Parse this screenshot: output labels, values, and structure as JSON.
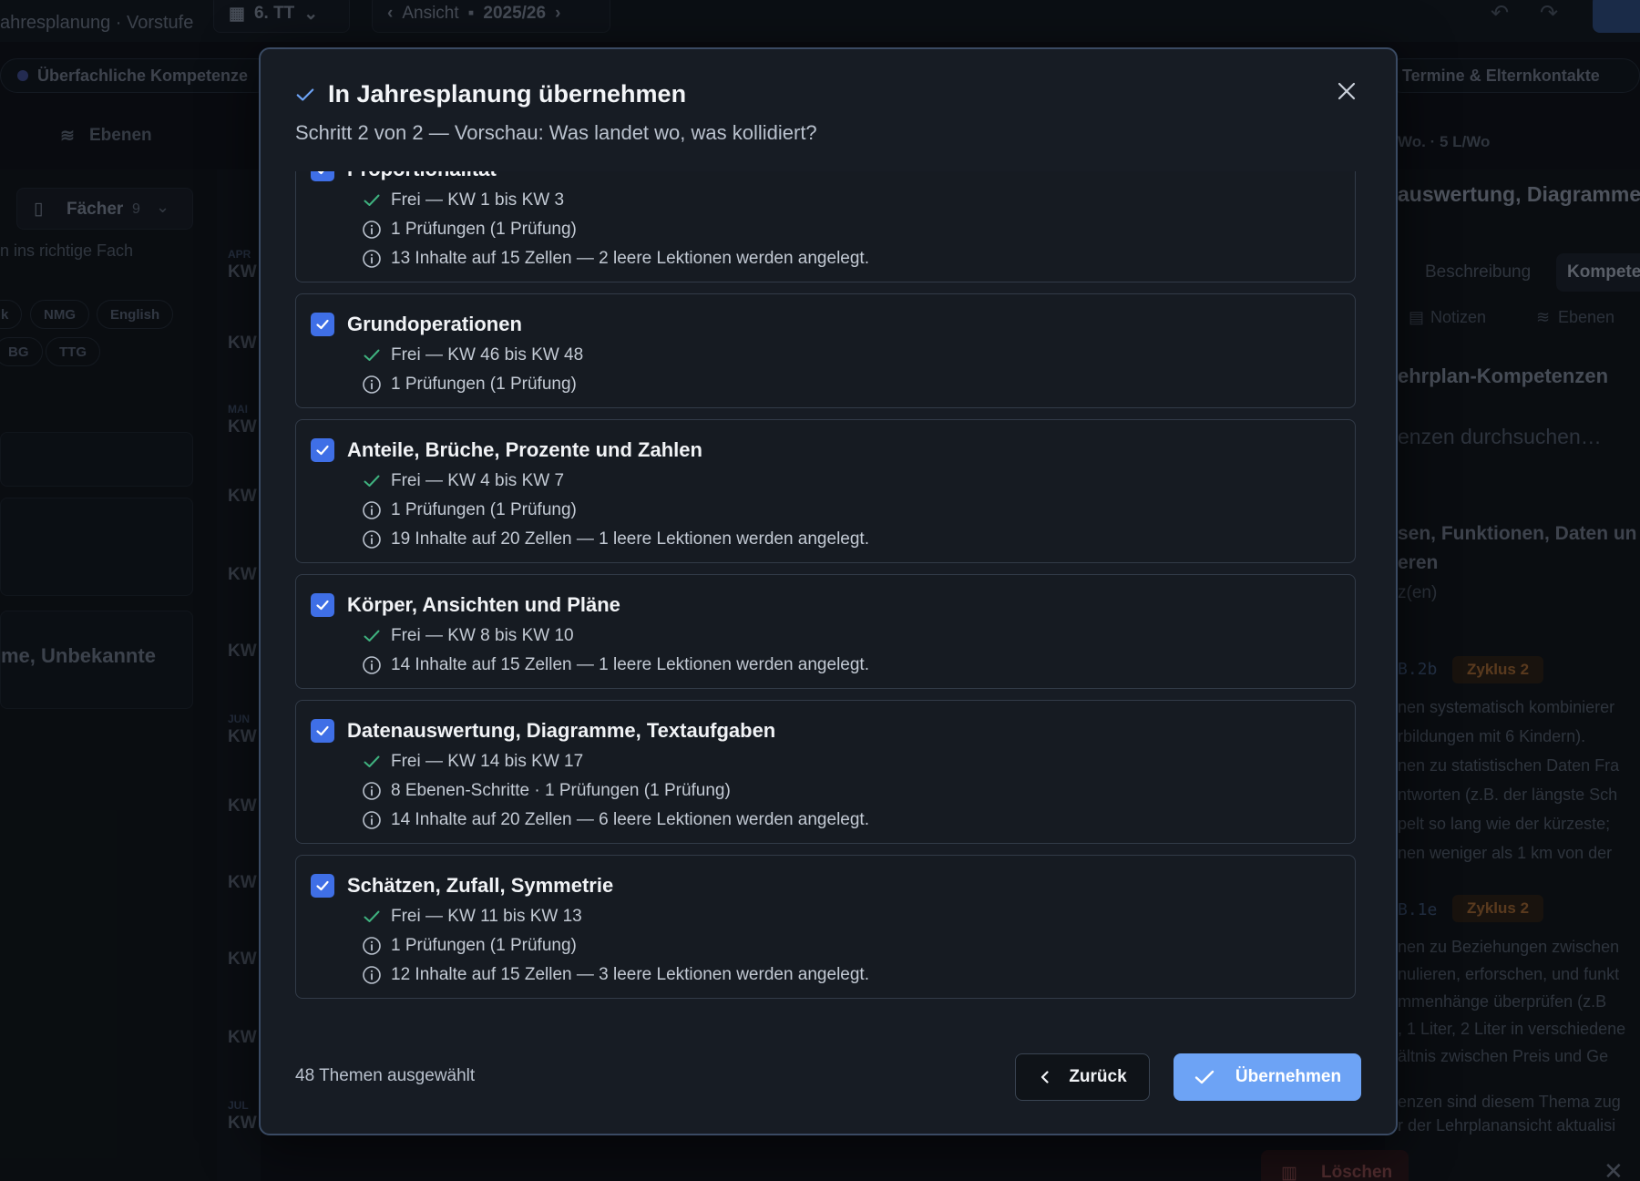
{
  "background": {
    "app_title": "ahresplanung · Vorstufe",
    "class_selector": "6. TT",
    "view_label": "Ansicht",
    "year": "2025/26",
    "pill_left": "Überfachliche Kompetenze",
    "pill_right": "Termine & Elternkontakte",
    "levels_label": "Ebenen",
    "subjects_label": "Fächer",
    "subjects_count": "9",
    "drop_hint": "n ins richtige Fach",
    "chips": [
      "k",
      "NMG",
      "English",
      "BG",
      "TTG"
    ],
    "left_card_text": "me, Unbekannte",
    "months": [
      "APR",
      "MAI",
      "JUN",
      "JUL"
    ],
    "kw_label": "KW",
    "right_header": "Wo. · 5 L/Wo",
    "right_title": "auswertung, Diagramme",
    "right_tabs": [
      "Beschreibung",
      "Kompete"
    ],
    "right_subtabs": [
      "Notizen",
      "Ebenen"
    ],
    "right_section": "ehrplan-Kompetenzen",
    "right_search": "enzen durchsuchen…",
    "right_topic": "sen, Funktionen, Daten un",
    "right_topic2": "eren",
    "right_topic3": "z(en)",
    "code1": "B.2b",
    "code2": "B.1e",
    "zyklus": "Zyklus 2",
    "right_text1": [
      "nen systematisch kombinierer",
      "rbildungen mit 6 Kindern).",
      "nen zu statistischen Daten Fra",
      "ntworten (z.B. der längste Sch",
      "pelt so lang wie der kürzeste;",
      "nen weniger als 1 km von der"
    ],
    "right_text2": [
      "nen zu Beziehungen zwischen",
      "nulieren, erforschen, und funkt",
      "mmenhänge überprüfen (z.B",
      ", 1 Liter, 2 Liter in verschiedene",
      "ältnis zwischen Preis und Ge"
    ],
    "right_bottom": [
      "enzen sind diesem Thema zug",
      "r der Lehrplanansicht aktualisi"
    ],
    "delete_label": "Löschen"
  },
  "modal": {
    "title": "In Jahresplanung übernehmen",
    "subtitle": "Schritt 2 von 2 — Vorschau: Was landet wo, was kollidiert?",
    "topics": [
      {
        "name": "Proportionalität",
        "lines": [
          {
            "icon": "check",
            "text": "Frei — KW 1 bis KW 3"
          },
          {
            "icon": "info",
            "text": "1 Prüfungen (1 Prüfung)"
          },
          {
            "icon": "info",
            "text": "13 Inhalte auf 15 Zellen — 2 leere Lektionen werden angelegt."
          }
        ]
      },
      {
        "name": "Grundoperationen",
        "lines": [
          {
            "icon": "check",
            "text": "Frei — KW 46 bis KW 48"
          },
          {
            "icon": "info",
            "text": "1 Prüfungen (1 Prüfung)"
          }
        ]
      },
      {
        "name": "Anteile, Brüche, Prozente und Zahlen",
        "lines": [
          {
            "icon": "check",
            "text": "Frei — KW 4 bis KW 7"
          },
          {
            "icon": "info",
            "text": "1 Prüfungen (1 Prüfung)"
          },
          {
            "icon": "info",
            "text": "19 Inhalte auf 20 Zellen — 1 leere Lektionen werden angelegt."
          }
        ]
      },
      {
        "name": "Körper, Ansichten und Pläne",
        "lines": [
          {
            "icon": "check",
            "text": "Frei — KW 8 bis KW 10"
          },
          {
            "icon": "info",
            "text": "14 Inhalte auf 15 Zellen — 1 leere Lektionen werden angelegt."
          }
        ]
      },
      {
        "name": "Datenauswertung, Diagramme, Textaufgaben",
        "lines": [
          {
            "icon": "check",
            "text": "Frei — KW 14 bis KW 17"
          },
          {
            "icon": "info",
            "text": "8 Ebenen-Schritte · 1 Prüfungen (1 Prüfung)"
          },
          {
            "icon": "info",
            "text": "14 Inhalte auf 20 Zellen — 6 leere Lektionen werden angelegt."
          }
        ]
      },
      {
        "name": "Schätzen, Zufall, Symmetrie",
        "lines": [
          {
            "icon": "check",
            "text": "Frei — KW 11 bis KW 13"
          },
          {
            "icon": "info",
            "text": "1 Prüfungen (1 Prüfung)"
          },
          {
            "icon": "info",
            "text": "12 Inhalte auf 15 Zellen — 3 leere Lektionen werden angelegt."
          }
        ]
      }
    ],
    "selected_count": "48 Themen ausgewählt",
    "back_label": "Zurück",
    "confirm_label": "Übernehmen"
  },
  "colors": {
    "accent": "#3f6fe6",
    "confirm": "#6da3f5",
    "check": "#3fb27f",
    "zyklus": "#a0652e"
  }
}
